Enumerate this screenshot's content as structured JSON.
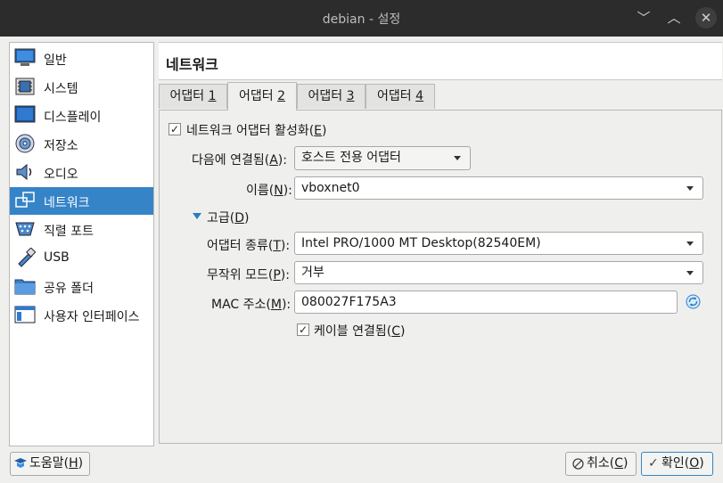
{
  "window": {
    "title": "debian - 설정"
  },
  "sidebar": {
    "items": [
      {
        "label": "일반",
        "icon": "monitor-icon"
      },
      {
        "label": "시스템",
        "icon": "chip-icon"
      },
      {
        "label": "디스플레이",
        "icon": "display-icon"
      },
      {
        "label": "저장소",
        "icon": "disk-icon"
      },
      {
        "label": "오디오",
        "icon": "speaker-icon"
      },
      {
        "label": "네트워크",
        "icon": "network-icon",
        "active": true
      },
      {
        "label": "직렬 포트",
        "icon": "serial-port-icon"
      },
      {
        "label": "USB",
        "icon": "usb-icon"
      },
      {
        "label": "공유 폴더",
        "icon": "folder-icon"
      },
      {
        "label": "사용자 인터페이스",
        "icon": "ui-icon"
      }
    ]
  },
  "header": {
    "title": "네트워크"
  },
  "tabs": [
    {
      "pre": "어댑터 ",
      "key": "1"
    },
    {
      "pre": "어댑터 ",
      "key": "2",
      "active": true
    },
    {
      "pre": "어댑터 ",
      "key": "3"
    },
    {
      "pre": "어댑터 ",
      "key": "4"
    }
  ],
  "form": {
    "enable": {
      "pre": "네트워크 어댑터 활성화(",
      "key": "E",
      "post": ")",
      "checked": true
    },
    "attached": {
      "pre": "다음에 연결됨(",
      "key": "A",
      "post": "):",
      "value": "호스트 전용 어댑터"
    },
    "name": {
      "pre": "이름(",
      "key": "N",
      "post": "):",
      "value": "vboxnet0"
    },
    "advanced": {
      "pre": "고급(",
      "key": "D",
      "post": ")"
    },
    "adapter_type": {
      "pre": "어댑터 종류(",
      "key": "T",
      "post": "):",
      "value": "Intel PRO/1000 MT Desktop(82540EM)"
    },
    "promisc": {
      "pre": "무작위 모드(",
      "key": "P",
      "post": "):",
      "value": "거부"
    },
    "mac": {
      "pre": "MAC 주소(",
      "key": "M",
      "post": "):",
      "value": "080027F175A3"
    },
    "cable": {
      "pre": "케이블 연결됨(",
      "key": "C",
      "post": ")",
      "checked": true
    }
  },
  "buttons": {
    "help": {
      "pre": "도움말(",
      "key": "H",
      "post": ")"
    },
    "cancel": {
      "pre": "취소(",
      "key": "C",
      "post": ")"
    },
    "ok": {
      "pre": "확인(",
      "key": "O",
      "post": ")"
    }
  },
  "colors": {
    "accent": "#3584c8",
    "titlebar": "#2c2c2c"
  }
}
